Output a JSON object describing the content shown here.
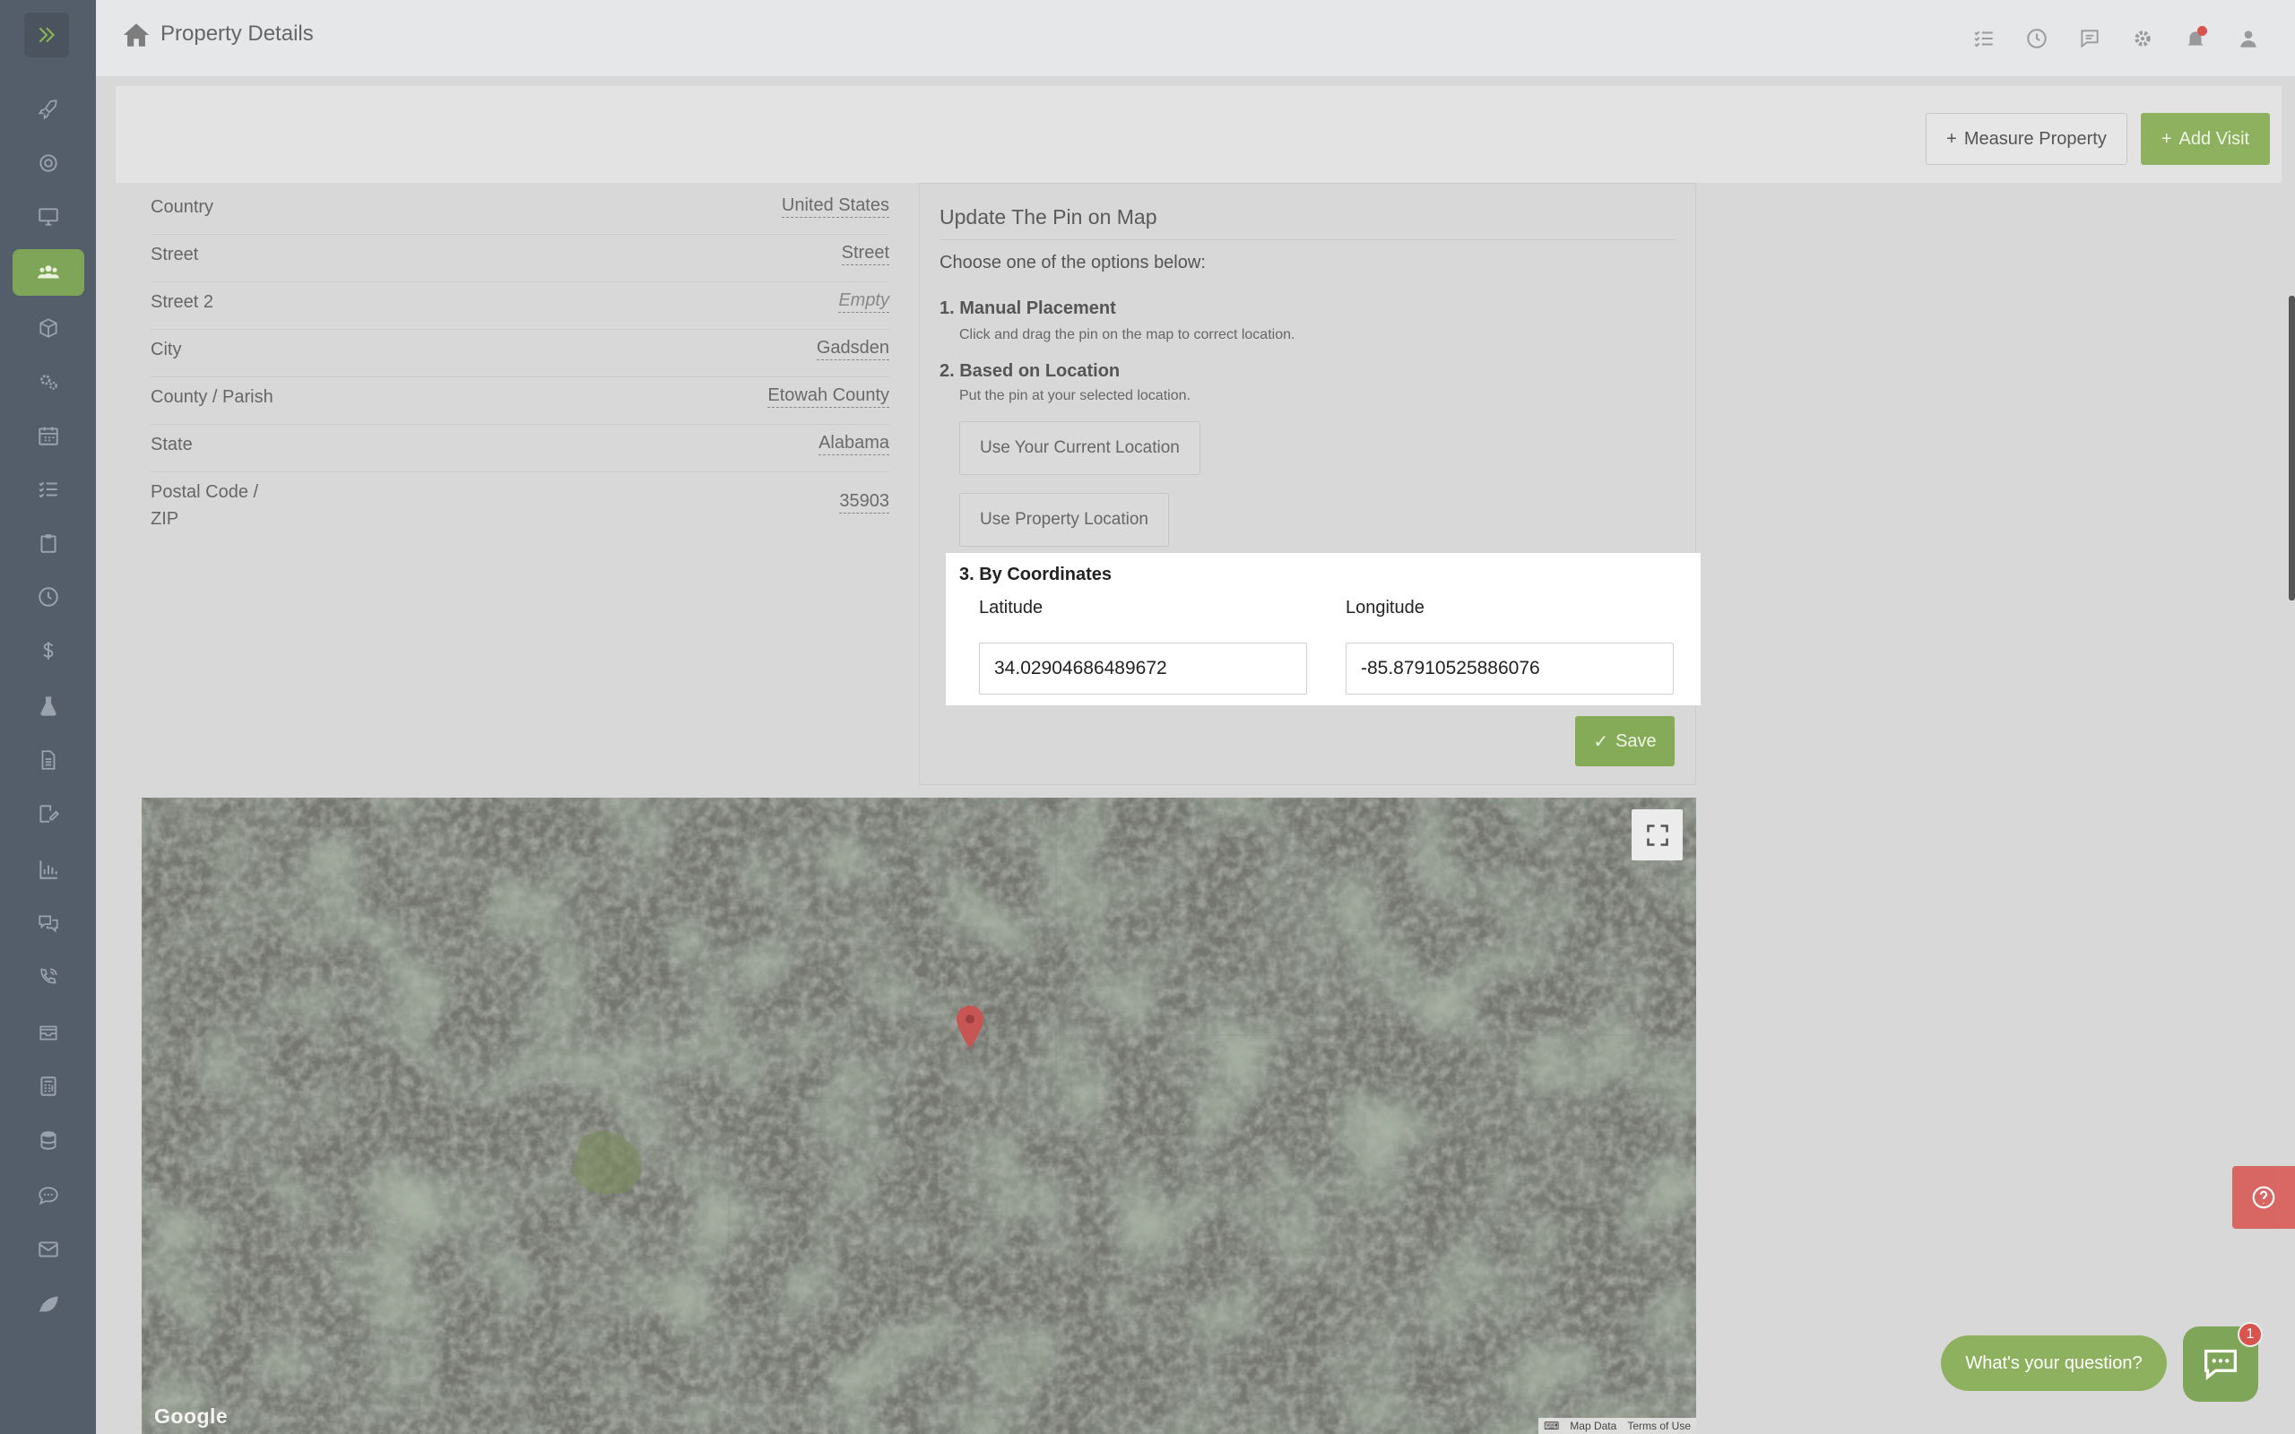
{
  "header": {
    "title": "Property Details"
  },
  "toolbar": {
    "measure_label": "Measure Property",
    "add_visit_label": "Add Visit"
  },
  "address": [
    {
      "label": "Country",
      "value": "United States"
    },
    {
      "label": "Street",
      "value": "Street"
    },
    {
      "label": "Street 2",
      "value": "Empty"
    },
    {
      "label": "City",
      "value": "Gadsden"
    },
    {
      "label": "County / Parish",
      "value": "Etowah County"
    },
    {
      "label": "State",
      "value": "Alabama"
    },
    {
      "label": "Postal Code / ZIP",
      "value": "35903"
    }
  ],
  "pin": {
    "title": "Update The Pin on Map",
    "subtitle": "Choose one of the options below:",
    "opt1_title": "1. Manual Placement",
    "opt1_desc": "Click and drag the pin on the map to correct location.",
    "opt2_title": "2. Based on Location",
    "opt2_desc": "Put the pin at your selected location.",
    "btn_current": "Use Your Current Location",
    "btn_property": "Use Property Location",
    "opt3_title": "3. By Coordinates",
    "lat_label": "Latitude",
    "lng_label": "Longitude",
    "lat_value": "34.02904686489672",
    "lng_value": "-85.87910525886076",
    "save_label": "Save"
  },
  "map": {
    "google": "Google",
    "map_data": "Map Data",
    "terms": "Terms of Use"
  },
  "chat": {
    "prompt": "What's your question?",
    "badge": "1"
  },
  "colors": {
    "accent": "#8db15e",
    "sidebar": "#545e6a",
    "danger": "#d9534f"
  }
}
